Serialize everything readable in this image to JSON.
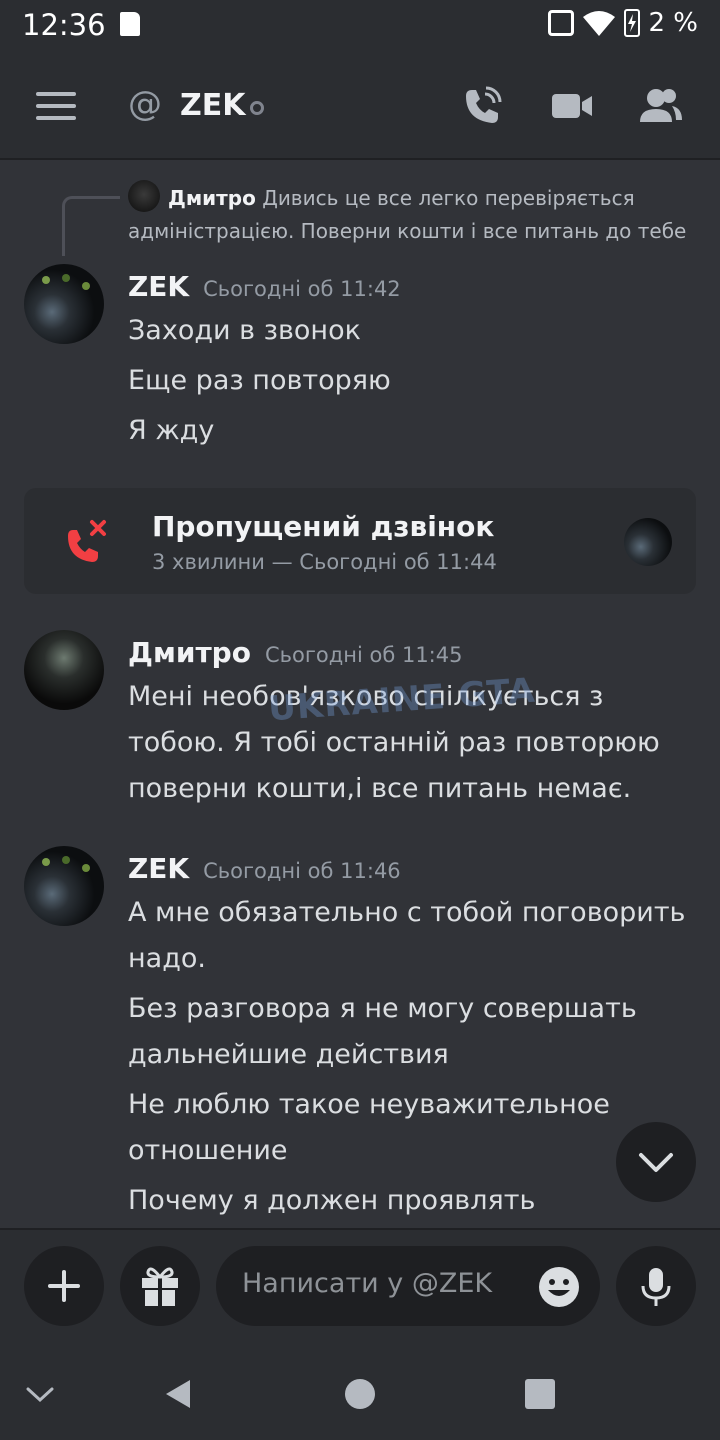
{
  "status_bar": {
    "time": "12:36",
    "battery": "2 %"
  },
  "header": {
    "at": "@",
    "title": "ZEK"
  },
  "reply": {
    "author": "Дмитро",
    "text": "Дивись це все легко перевіряється адміністрацією. Поверни кошти і все питань до тебе"
  },
  "messages": [
    {
      "author": "ZEK",
      "time": "Сьогодні об 11:42",
      "lines": [
        "Заходи в звонок",
        "Еще раз повторяю",
        "Я жду"
      ]
    },
    {
      "author": "Дмитро",
      "time": "Сьогодні об 11:45",
      "lines": [
        "Мені необов'язково спілкується з тобою. Я тобі останній раз повторюю поверни кошти,і все питань немає."
      ]
    },
    {
      "author": "ZEK",
      "time": "Сьогодні об 11:46",
      "lines": [
        "А мне обязательно с тобой поговорить надо.",
        "Без разговора я не могу совершать дальнейшие действия",
        "Не люблю такое неуважительное отношение",
        "Почему я должен проявлять"
      ]
    }
  ],
  "missed_call": {
    "title": "Пропущений дзвінок",
    "subtitle": "3 хвилини — Сьогодні об 11:44"
  },
  "composer": {
    "placeholder": "Написати у @ZEK"
  },
  "watermark": "UKRAINE GTA",
  "colors": {
    "background": "#313338",
    "header": "#2b2d31",
    "missed_call_red": "#f23f43",
    "text": "#dbdee1",
    "muted": "#949ba4"
  },
  "icons": {
    "menu": "hamburger-icon",
    "call": "phone-call-icon",
    "video": "video-camera-icon",
    "members": "people-icon",
    "missed_call": "missed-call-icon",
    "scroll": "chevron-down-icon",
    "add": "plus-icon",
    "gift": "gift-icon",
    "emoji": "emoji-icon",
    "mic": "microphone-icon"
  }
}
